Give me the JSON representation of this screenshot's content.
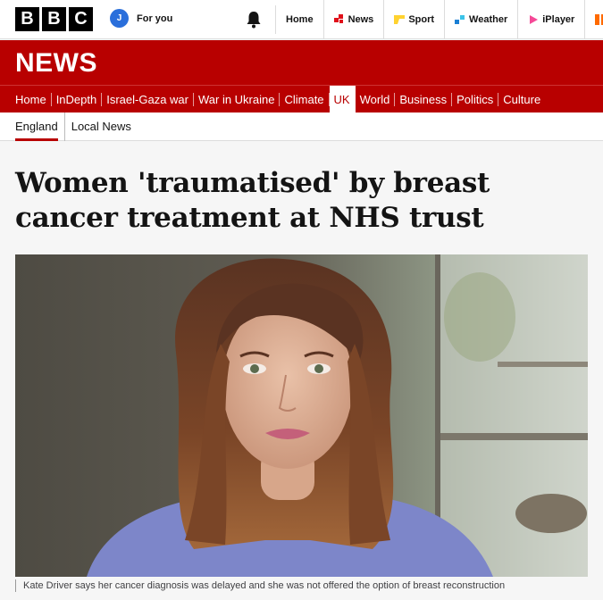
{
  "header": {
    "logo_letters": [
      "B",
      "B",
      "C"
    ],
    "avatar_initial": "J",
    "for_you_label": "For you",
    "links": [
      {
        "label": "Home",
        "icon": "none"
      },
      {
        "label": "News",
        "icon": "news-icon",
        "color": "#e0101a"
      },
      {
        "label": "Sport",
        "icon": "sport-icon",
        "color": "#ffd230"
      },
      {
        "label": "Weather",
        "icon": "weather-icon",
        "color": "#1a7fd4"
      },
      {
        "label": "iPlayer",
        "icon": "iplayer-icon",
        "color": "#f54997"
      }
    ]
  },
  "news_banner": {
    "title": "NEWS",
    "color": "#b80000"
  },
  "nav": {
    "items": [
      "Home",
      "InDepth",
      "Israel-Gaza war",
      "War in Ukraine",
      "Climate",
      "UK",
      "World",
      "Business",
      "Politics",
      "Culture"
    ],
    "active": "UK"
  },
  "subnav": {
    "items": [
      "England",
      "Local News"
    ],
    "active": "England"
  },
  "article": {
    "headline": "Women 'traumatised' by breast cancer treatment at NHS trust",
    "image_caption": "Kate Driver says her cancer diagnosis was delayed and she was not offered the option of breast reconstruction"
  }
}
